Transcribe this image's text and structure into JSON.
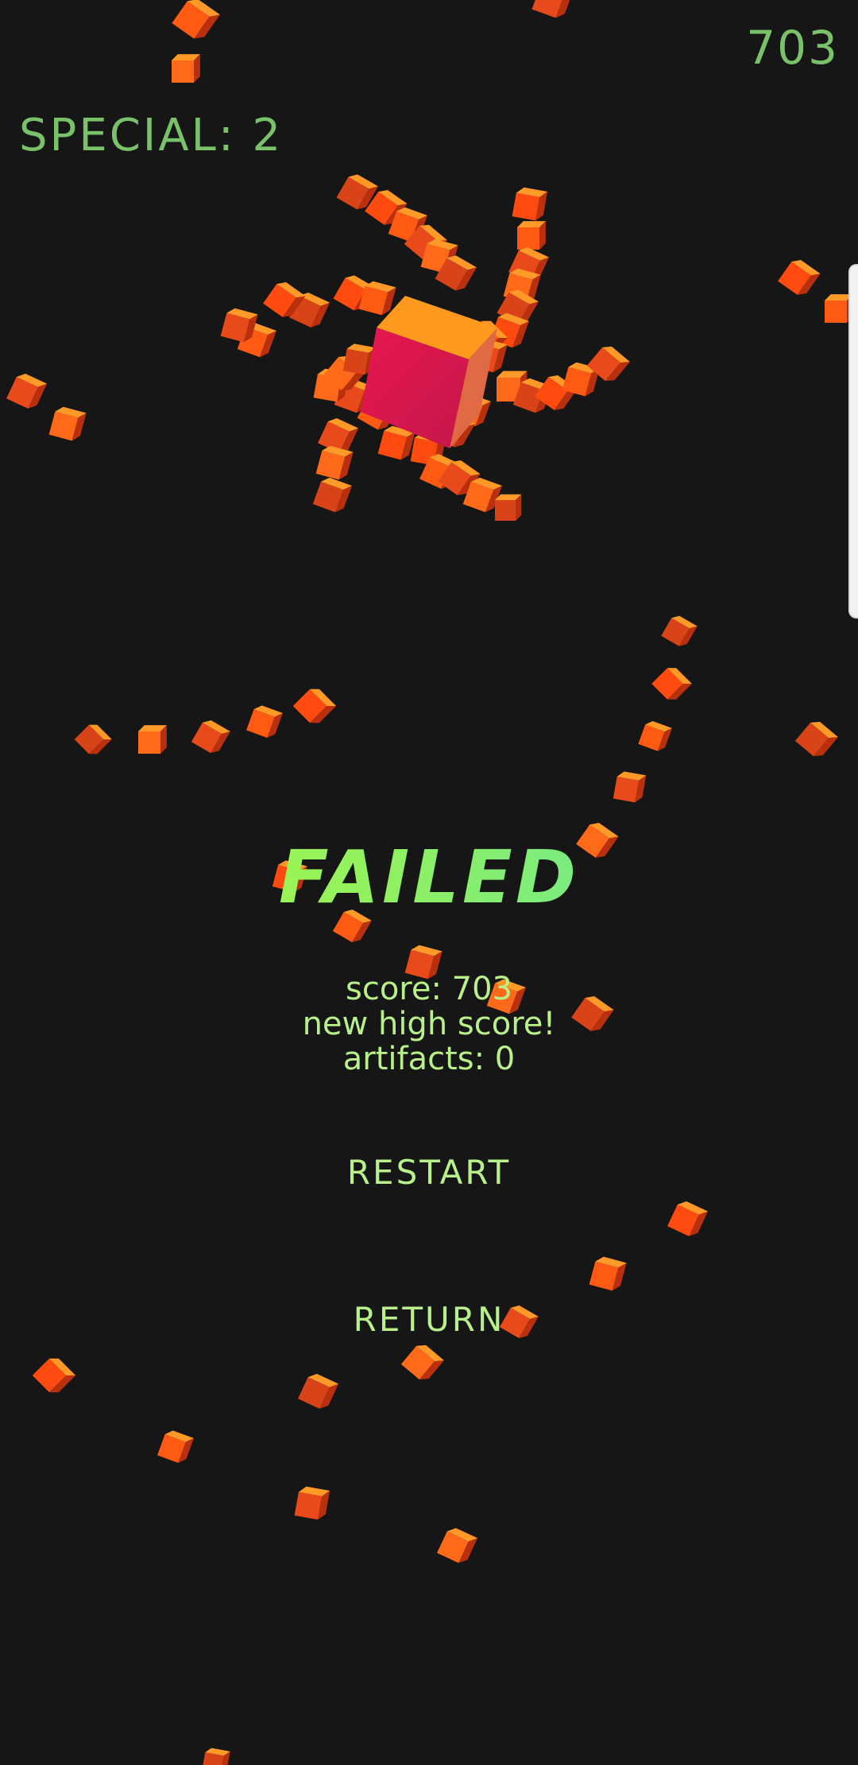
{
  "hud": {
    "score": "703",
    "special": "SPECIAL: 2"
  },
  "result": {
    "title": "FAILED",
    "score_line": "score: 703",
    "high_score_line": "new high score!",
    "artifacts_line": "artifacts: 0"
  },
  "menu": {
    "restart_label": "RESTART",
    "return_label": "RETURN"
  },
  "colors": {
    "background": "#161616",
    "hud_text": "#79c26a",
    "menu_text": "#b8f08a",
    "cube_orange": "#ff6a1a",
    "cube_red": "#e8401c",
    "player_cube": "#d81b4d"
  },
  "icons": {
    "particle": "small-orange-cube",
    "player": "large-pink-cube",
    "edge_panel": "edge-panel-handle"
  }
}
